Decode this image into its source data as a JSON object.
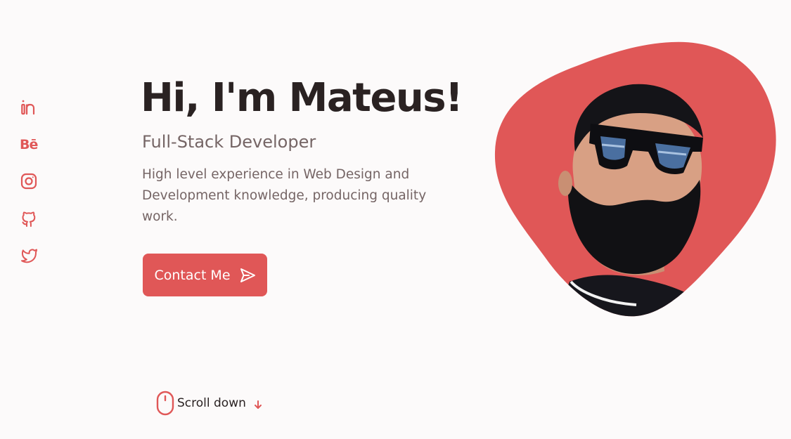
{
  "social": {
    "items": [
      {
        "name": "linkedin",
        "icon": "linkedin-icon"
      },
      {
        "name": "behance",
        "icon": "behance-icon",
        "glyph": "Bē"
      },
      {
        "name": "instagram",
        "icon": "instagram-icon"
      },
      {
        "name": "github",
        "icon": "github-icon"
      },
      {
        "name": "twitter",
        "icon": "twitter-icon"
      }
    ]
  },
  "hero": {
    "title": "Hi, I'm Mateus!",
    "subtitle": "Full-Stack Developer",
    "description": "High level experience in Web Design and Development knowledge, producing quality work.",
    "contact_label": "Contact Me",
    "contact_icon": "send-icon"
  },
  "scroll": {
    "label": "Scroll down",
    "mouse_icon": "mouse-icon",
    "arrow_icon": "arrow-down-icon"
  },
  "colors": {
    "accent": "#e05757",
    "background": "#fcfafa",
    "title": "#2a2222",
    "text": "#756565"
  }
}
